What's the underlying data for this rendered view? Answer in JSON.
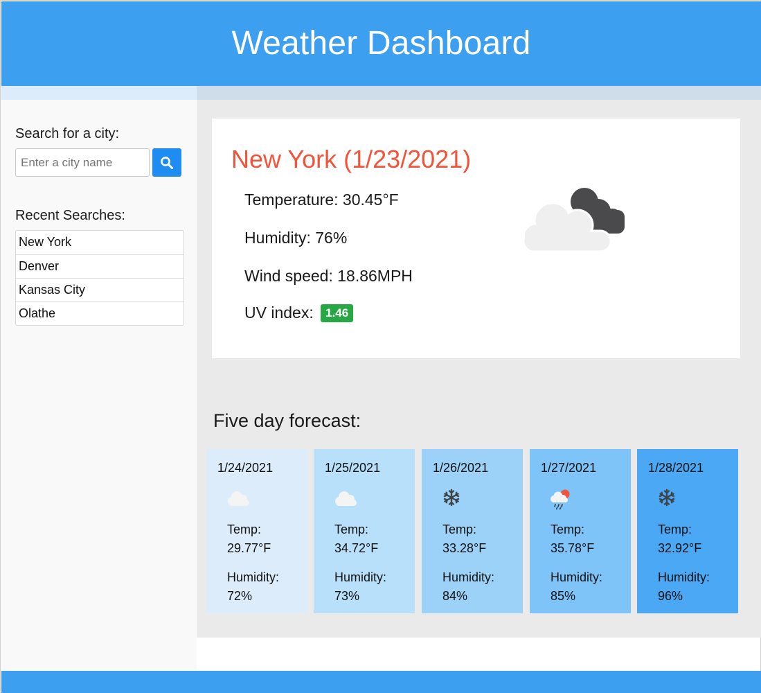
{
  "header": {
    "title": "Weather Dashboard"
  },
  "sidebar": {
    "search_label": "Search for a city:",
    "search_placeholder": "Enter a city name",
    "search_value": "",
    "search_button_icon": "search-icon",
    "recent_label": "Recent Searches:",
    "recent": [
      "New York",
      "Denver",
      "Kansas City",
      "Olathe"
    ]
  },
  "current": {
    "title": "New York (1/23/2021)",
    "temperature": "Temperature: 30.45°F",
    "humidity": "Humidity: 76%",
    "wind": "Wind speed: 18.86MPH",
    "uv_label": "UV index:",
    "uv_value": "1.46",
    "icon": "night-cloudy-icon"
  },
  "forecast": {
    "title": "Five day forecast:",
    "temp_label": "Temp:",
    "humidity_label": "Humidity:",
    "days": [
      {
        "date": "1/24/2021",
        "icon": "cloud-icon",
        "temp": "29.77°F",
        "humidity": "72%"
      },
      {
        "date": "1/25/2021",
        "icon": "cloud-icon",
        "temp": "34.72°F",
        "humidity": "73%"
      },
      {
        "date": "1/26/2021",
        "icon": "snowflake-icon",
        "temp": "33.28°F",
        "humidity": "84%"
      },
      {
        "date": "1/27/2021",
        "icon": "rain-sun-icon",
        "temp": "35.78°F",
        "humidity": "85%"
      },
      {
        "date": "1/28/2021",
        "icon": "snowflake-icon",
        "temp": "32.92°F",
        "humidity": "96%"
      }
    ]
  },
  "colors": {
    "header": "#3d9ff0",
    "accent_button": "#1e8cf0",
    "city_title": "#f2543a",
    "uv_badge": "#28a745",
    "forecast_cards": [
      "#dcecfb",
      "#b9e0fb",
      "#9dd2f8",
      "#7fc4f8",
      "#4aa8f4"
    ]
  }
}
